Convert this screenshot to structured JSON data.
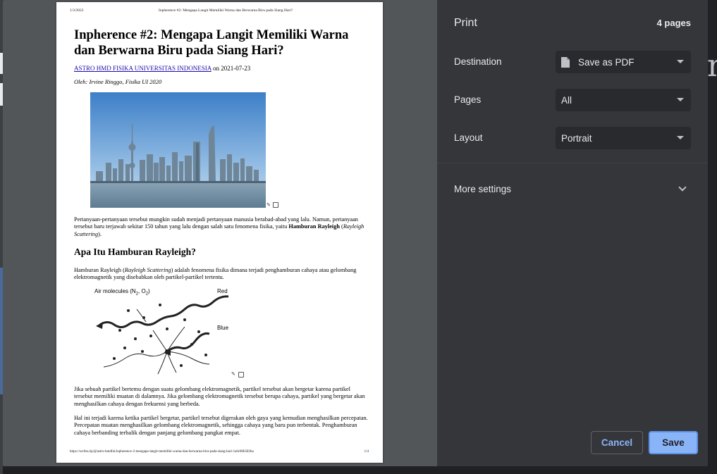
{
  "preview": {
    "header_date": "1/3/2022",
    "header_title": "Inpherence #2: Mengapa Langit Memiliki Warna dan Berwarna Biru pada Siang Hari?",
    "title": "Inpherence #2: Mengapa Langit Memiliki Warna dan Berwarna Biru pada Siang Hari?",
    "byline_link": "ASTRO HMD FISIKA UNIVERSITAS INDONESIA",
    "byline_date": " on 2021-07-23",
    "author": "Oleh: Irvine Ringgo, Fisika UI 2020",
    "para1_a": "Pertanyaan-pertanyaan tersebut mungkin sudah menjadi pertanyaan manusia berabad-abad yang lalu. Namun, pertanyaan tersebut baru terjawab sekitar 150 tahun yang lalu dengan salah satu fenomena fisika, yaitu ",
    "para1_bold": "Hamburan Rayleigh",
    "para1_b": " (",
    "para1_italic": "Rayleigh Scattering",
    "para1_c": ").",
    "heading2": "Apa Itu Hamburan Rayleigh?",
    "para2_a": "Hamburan Rayleigh (",
    "para2_italic": "Rayleigh Scattering",
    "para2_b": ") adalah fenomena fisika dimana terjadi penghamburan cahaya atau gelombang elektromagnetik yang disebabkan oleh partikel-partikel tertentu.",
    "diagram_label_air": "Air molecules (N",
    "diagram_sub1": "2",
    "diagram_comma": ", O",
    "diagram_sub2": "2",
    "diagram_close": ")",
    "diagram_label_red": "Red",
    "diagram_label_blue": "Blue",
    "para3": "Jika sebuah partikel bertemu dengan suatu gelombang elektromagnetik, partikel tersebut akan bergetar karena partikel tersebut memiliki muatan di dalamnya. Jika gelombang elektromagnetik tersebut berupa cahaya, partikel yang bergetar akan menghasilkan cahaya dengan frekuensi yang berbeda.",
    "para4": "Hal ini terjadi karena ketika partikel bergetar, partikel tersebut digerakan oleh gaya yang kemudian menghasilkan percepatan. Percepatan muatan menghasilkan gelombang elektromagnetik, sehingga cahaya yang baru pun terbentuk. Penghamburan cahaya berbanding terbalik dengan panjang gelombang pangkat empat.",
    "footer_url": "https://scribe.rip/@astro-hmdfui/inpherence-2-mengapa-langit-memiliki-warna-dan-berwarna-biru-pada-siang-hari-1a6c80b583ba",
    "footer_page": "1/4"
  },
  "settings": {
    "title": "Print",
    "page_count": "4 pages",
    "destination_label": "Destination",
    "destination_value": "Save as PDF",
    "pages_label": "Pages",
    "pages_value": "All",
    "layout_label": "Layout",
    "layout_value": "Portrait",
    "more_settings": "More settings",
    "cancel": "Cancel",
    "save": "Save"
  },
  "colors": {
    "accent": "#8ab4f8",
    "panel": "#35363a",
    "preview_bg": "#525659"
  },
  "background": {
    "letter": "n"
  }
}
